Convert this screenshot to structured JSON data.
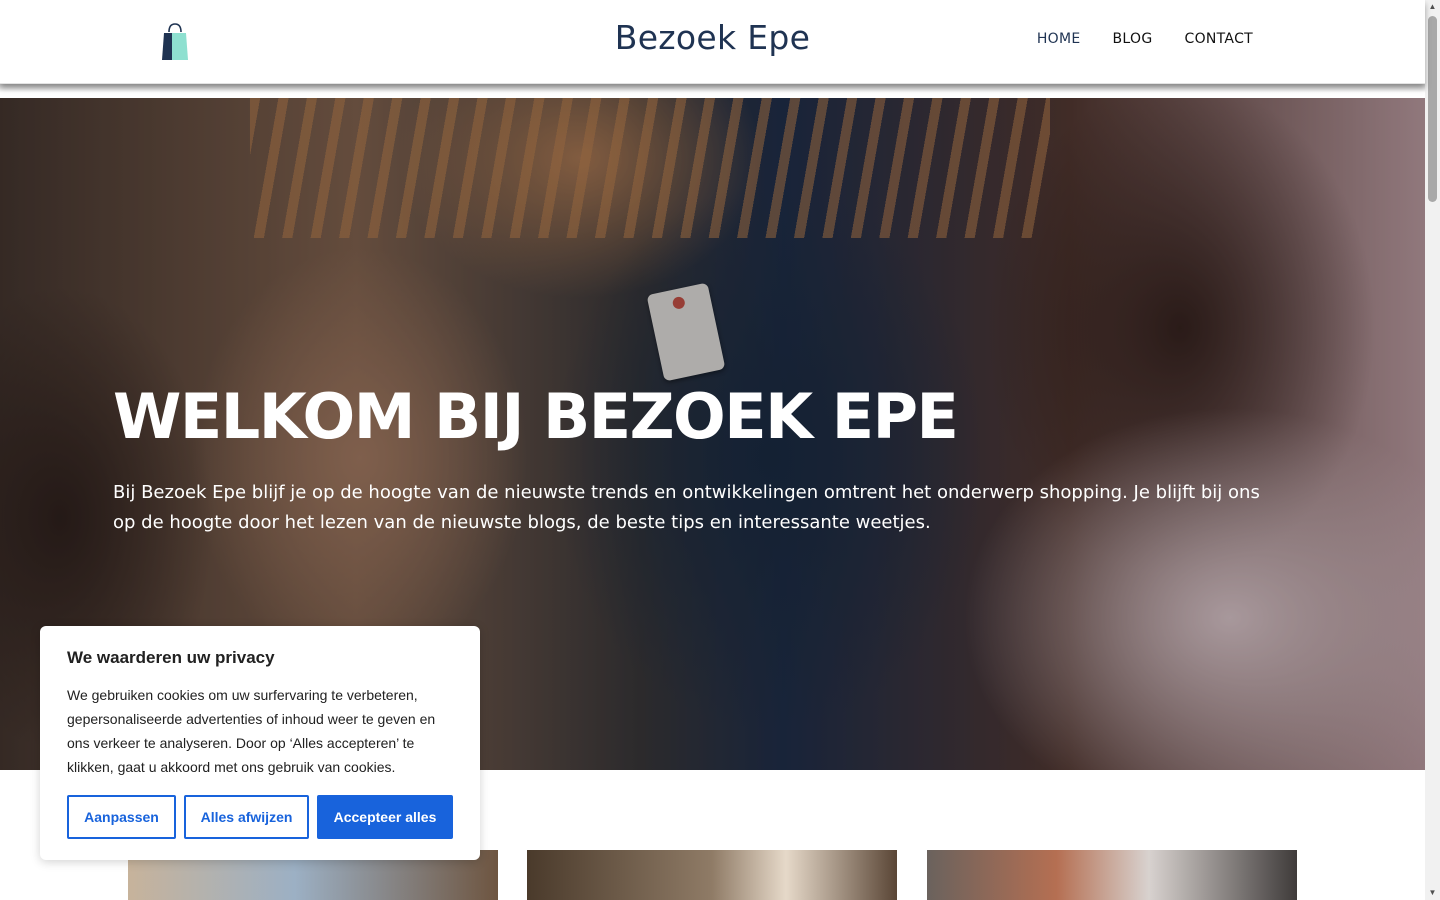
{
  "header": {
    "site_title": "Bezoek Epe",
    "logo_icon": "shopping-bag-icon",
    "nav": [
      {
        "label": "HOME",
        "active": true
      },
      {
        "label": "BLOG",
        "active": false
      },
      {
        "label": "CONTACT",
        "active": false
      }
    ]
  },
  "hero": {
    "title": "WELKOM BIJ BEZOEK EPE",
    "text": "Bij Bezoek Epe blijf je op de hoogte van de nieuwste trends en ontwikkelingen omtrent het onderwerp shopping. Je blijft bij ons op de hoogte door het lezen van de nieuwste blogs, de beste tips en interessante weetjes."
  },
  "cookie_banner": {
    "title": "We waarderen uw privacy",
    "text": "We gebruiken cookies om uw surfervaring te verbeteren, gepersonaliseerde advertenties of inhoud weer te geven en ons verkeer te analyseren. Door op ‘Alles accepteren’ te klikken, gaat u akkoord met ons gebruik van cookies.",
    "buttons": {
      "customize": "Aanpassen",
      "reject": "Alles afwijzen",
      "accept": "Accepteer alles"
    }
  },
  "colors": {
    "brand": "#1f3352",
    "cookie_accent": "#1863dc"
  }
}
